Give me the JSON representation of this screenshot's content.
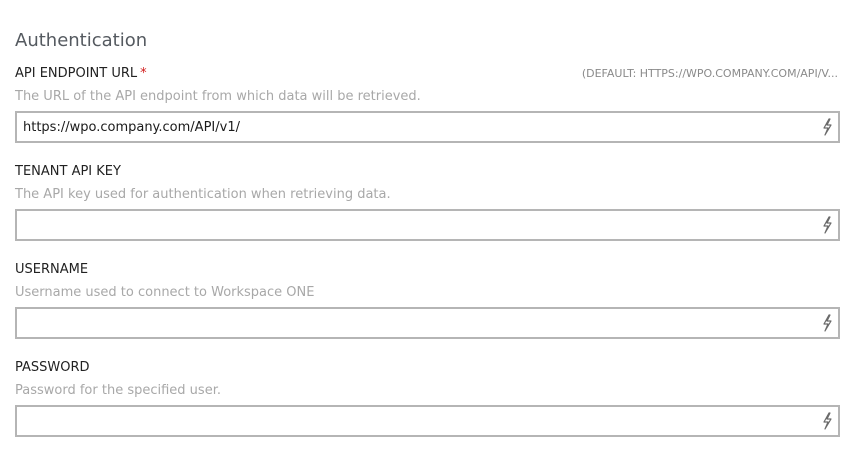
{
  "section": {
    "title": "Authentication"
  },
  "fields": [
    {
      "label": "API ENDPOINT URL",
      "required_mark": "*",
      "default_hint": "(DEFAULT: HTTPS://WPO.COMPANY.COM/API/V...",
      "description": "The URL of the API endpoint from which data will be retrieved.",
      "value": "https://wpo.company.com/API/v1/",
      "icon": "lightning-bolt-icon"
    },
    {
      "label": "TENANT API KEY",
      "description": "The API key used for authentication when retrieving data.",
      "value": "",
      "icon": "lightning-bolt-icon"
    },
    {
      "label": "USERNAME",
      "description": "Username used to connect to Workspace ONE",
      "value": "",
      "icon": "lightning-bolt-icon"
    },
    {
      "label": "PASSWORD",
      "description": "Password for the specified user.",
      "value": "",
      "icon": "lightning-bolt-icon"
    }
  ],
  "colors": {
    "required": "#d11a1a",
    "border": "#b5b5b5",
    "label": "#222222",
    "description": "#a8a8a8"
  }
}
